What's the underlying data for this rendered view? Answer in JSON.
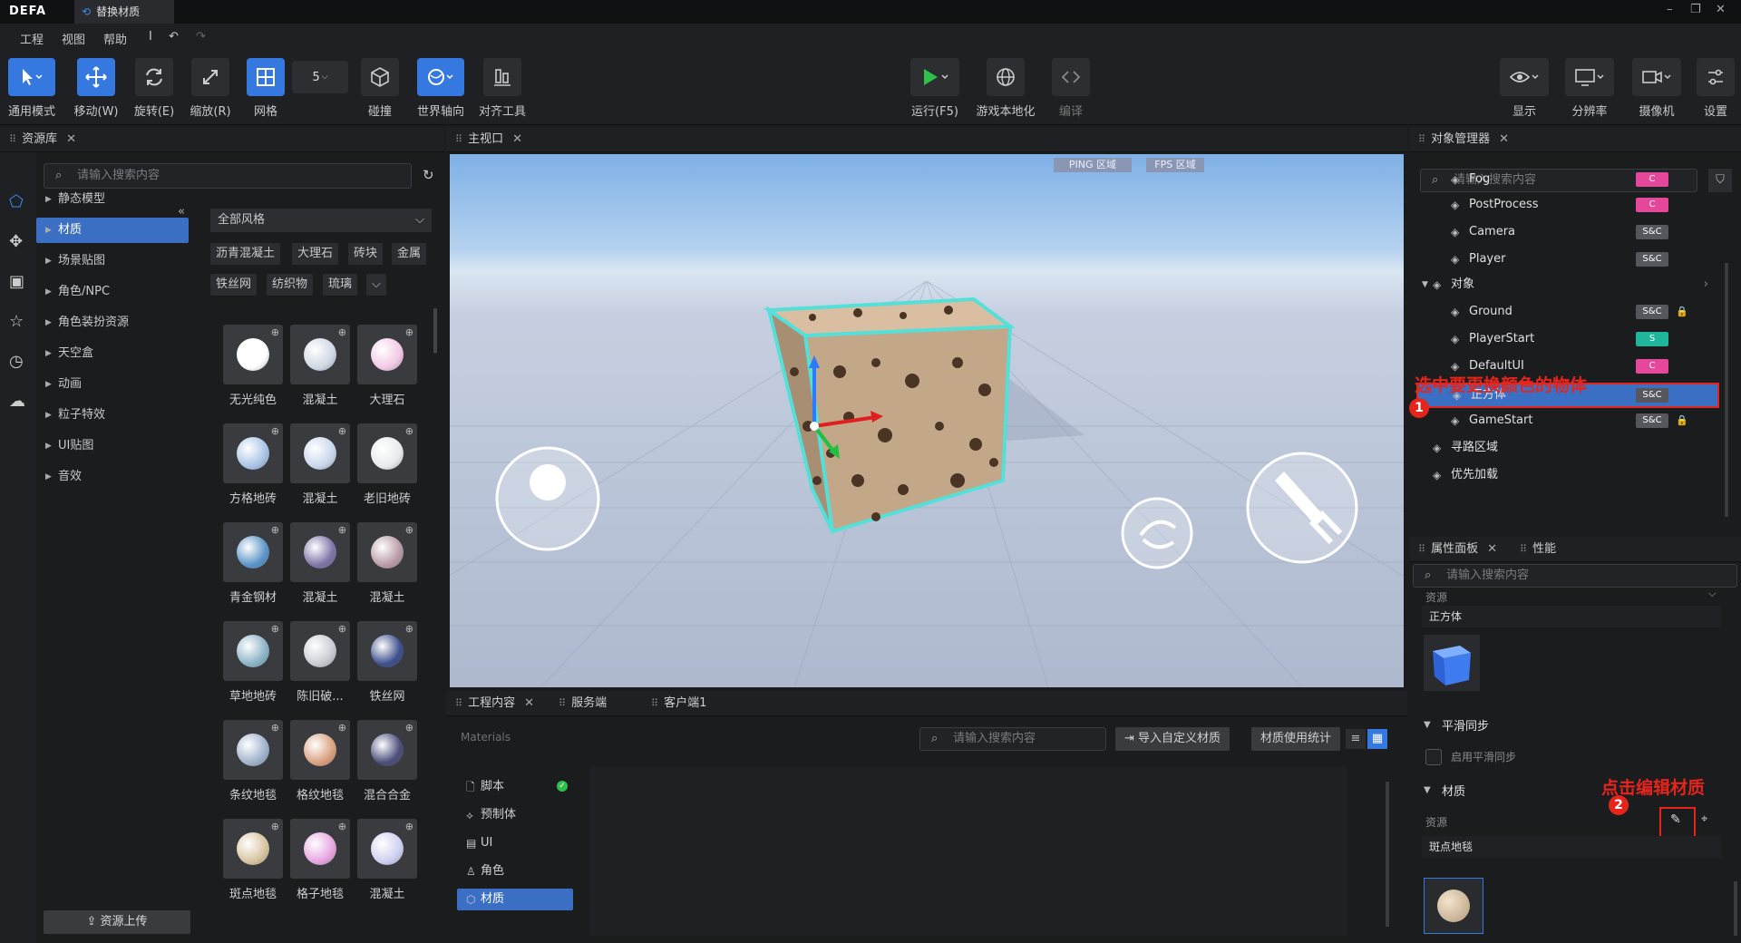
{
  "app": {
    "logo": "DEFA",
    "doc_tab": "替换材质"
  },
  "menu": [
    "工程",
    "视图",
    "帮助",
    "I"
  ],
  "toolbar": {
    "general": "通用模式",
    "move": "移动(W)",
    "rotate": "旋转(E)",
    "scale": "缩放(R)",
    "grid": "网格",
    "grid_size": "5",
    "collision": "碰撞",
    "world_axis": "世界轴向",
    "align": "对齐工具",
    "run": "运行(F5)",
    "localize": "游戏本地化",
    "compile": "编译",
    "display": "显示",
    "resolution": "分辨率",
    "camera": "摄像机",
    "settings": "设置"
  },
  "asset_lib": {
    "title": "资源库",
    "search_placeholder": "请输入搜索内容",
    "categories": [
      "静态模型",
      "材质",
      "场景贴图",
      "角色/NPC",
      "角色装扮资源",
      "天空盒",
      "动画",
      "粒子特效",
      "UI贴图",
      "音效"
    ],
    "selected_category": "材质",
    "style_filter": "全部风格",
    "chips_row1": [
      "沥青混凝土",
      "大理石",
      "砖块",
      "金属"
    ],
    "chips_row2": [
      "铁丝网",
      "纺织物",
      "琉璃"
    ],
    "upload": "资源上传",
    "materials": [
      "无光纯色",
      "混凝土",
      "大理石",
      "方格地砖",
      "混凝土",
      "老旧地砖",
      "青金钢材",
      "混凝土",
      "混凝土",
      "草地地砖",
      "陈旧破...",
      "铁丝网",
      "条纹地毯",
      "格纹地毯",
      "混合合金",
      "斑点地毯",
      "格子地毯",
      "混凝土"
    ],
    "material_colors": [
      "#ffffff",
      "#cfd8e4",
      "#f2c9e6",
      "#a9c4e6",
      "#c9d7ec",
      "#e8eaee",
      "#5b94c8",
      "#7f74a8",
      "#b89aa6",
      "#8bb3c6",
      "#c9ccd2",
      "#3d4f8c",
      "#9fb3cc",
      "#d9a080",
      "#4a4d78",
      "#d8c4a0",
      "#e6a6e0",
      "#cfd0f0"
    ]
  },
  "viewport": {
    "title": "主视口",
    "ping": "PING 区域",
    "fps": "FPS 区域"
  },
  "bottom": {
    "tabs": [
      "工程内容",
      "服务端",
      "客户端1"
    ],
    "path": "Materials",
    "search_placeholder": "请输入搜索内容",
    "import_btn": "导入自定义材质",
    "stats_btn": "材质使用统计",
    "tree": [
      "脚本",
      "预制体",
      "UI",
      "角色",
      "材质"
    ]
  },
  "object_mgr": {
    "title": "对象管理器",
    "search_placeholder": "请输入搜索内容",
    "rows": [
      {
        "name": "Fog",
        "tag": "C"
      },
      {
        "name": "PostProcess",
        "tag": "C"
      },
      {
        "name": "Camera",
        "tag": "S&C"
      },
      {
        "name": "Player",
        "tag": "S&C"
      },
      {
        "name": "对象",
        "tag": ""
      },
      {
        "name": "Ground",
        "tag": "S&C"
      },
      {
        "name": "PlayerStart",
        "tag": "S"
      },
      {
        "name": "DefaultUI",
        "tag": "C"
      },
      {
        "name": "正方体",
        "tag": "S&C"
      },
      {
        "name": "GameStart",
        "tag": "S&C"
      },
      {
        "name": "寻路区域",
        "tag": ""
      },
      {
        "name": "优先加载",
        "tag": ""
      }
    ],
    "annotation": "选中要更换颜色的物体",
    "badge": "1"
  },
  "props": {
    "tab1": "属性面板",
    "tab2": "性能",
    "search_placeholder": "请输入搜索内容",
    "top_label": "资源",
    "object_name": "正方体",
    "smooth_section": "平滑同步",
    "smooth_check": "启用平滑同步",
    "material_section": "材质",
    "res_label": "资源",
    "material_name": "斑点地毯",
    "annotation": "点击编辑材质",
    "badge": "2"
  }
}
